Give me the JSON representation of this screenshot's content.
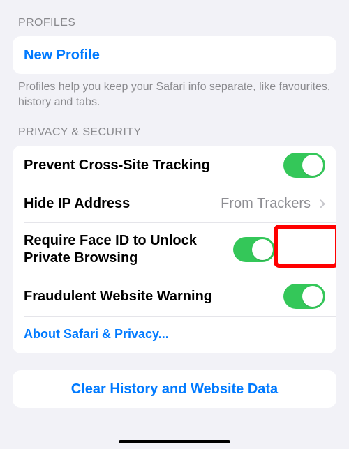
{
  "sections": {
    "profiles": {
      "header": "PROFILES",
      "new_profile": "New Profile",
      "footer": "Profiles help you keep your Safari info separate, like favourites, history and tabs."
    },
    "privacy": {
      "header": "PRIVACY & SECURITY",
      "prevent_cross_site": "Prevent Cross-Site Tracking",
      "hide_ip": "Hide IP Address",
      "hide_ip_value": "From Trackers",
      "require_faceid": "Require Face ID to Unlock Private Browsing",
      "fraudulent": "Fraudulent Website Warning",
      "about_link": "About Safari & Privacy..."
    },
    "clear": {
      "label": "Clear History and Website Data"
    }
  }
}
